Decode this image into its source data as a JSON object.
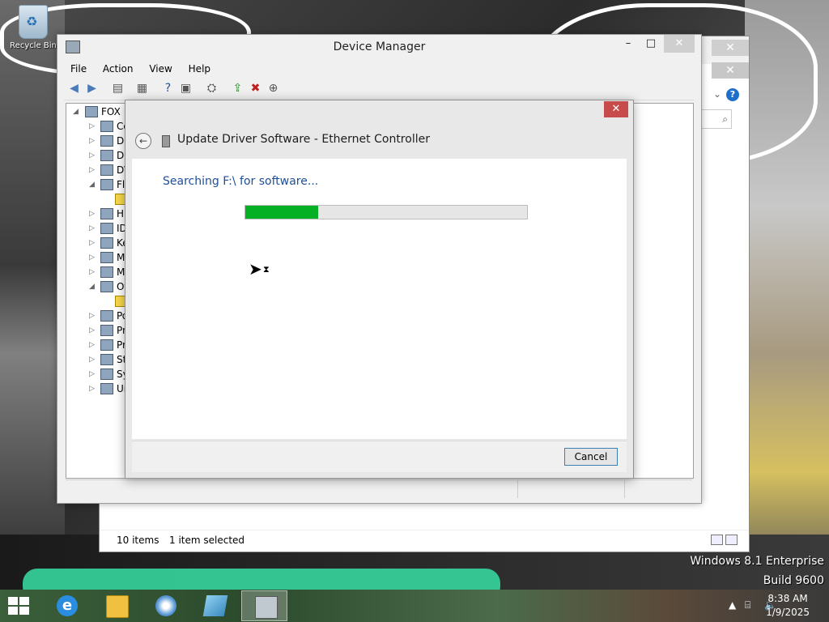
{
  "desktop": {
    "recycle_bin_label": "Recycle Bin"
  },
  "background_window": {
    "status_items": "10 items",
    "status_selected": "1 item selected"
  },
  "device_manager": {
    "title": "Device Manager",
    "menu": [
      "File",
      "Action",
      "View",
      "Help"
    ],
    "tree": {
      "root": "FOX",
      "items": [
        "Co",
        "Di",
        "Di",
        "DV",
        "Fl",
        "",
        "Hu",
        "ID",
        "Ke",
        "M",
        "M",
        "Ot",
        "",
        "Po",
        "Pr",
        "Pr",
        "St",
        "Sy",
        "Ur"
      ]
    }
  },
  "update_dialog": {
    "title": "Update Driver Software - Ethernet Controller",
    "status_text": "Searching F:\\ for software...",
    "progress": 0.26,
    "cancel_label": "Cancel"
  },
  "watermark": {
    "edition": "Windows 8.1 Enterprise",
    "build": "Build 9600"
  },
  "taskbar": {
    "time": "8:38 AM",
    "date": "1/9/2025",
    "accent": "#06b025"
  }
}
